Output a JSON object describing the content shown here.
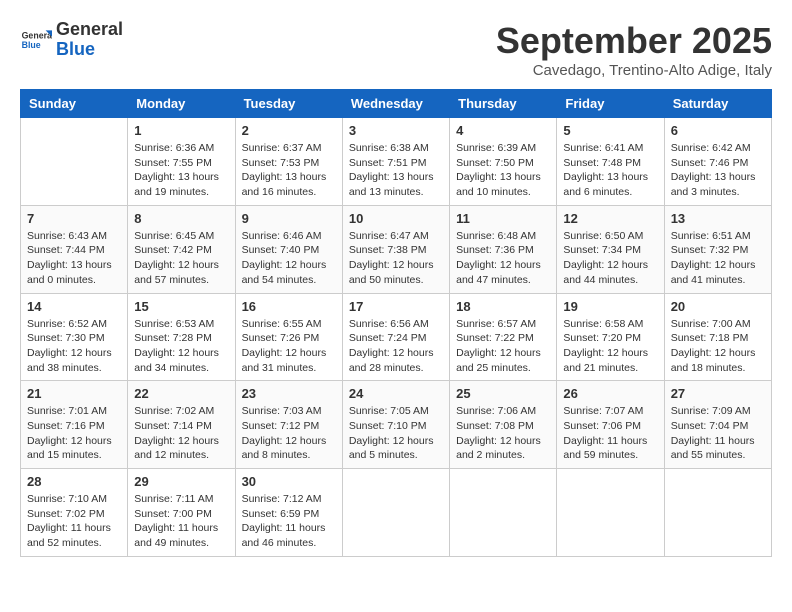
{
  "logo": {
    "general": "General",
    "blue": "Blue"
  },
  "header": {
    "title": "September 2025",
    "location": "Cavedago, Trentino-Alto Adige, Italy"
  },
  "days_of_week": [
    "Sunday",
    "Monday",
    "Tuesday",
    "Wednesday",
    "Thursday",
    "Friday",
    "Saturday"
  ],
  "weeks": [
    [
      {
        "day": "",
        "info": ""
      },
      {
        "day": "1",
        "info": "Sunrise: 6:36 AM\nSunset: 7:55 PM\nDaylight: 13 hours\nand 19 minutes."
      },
      {
        "day": "2",
        "info": "Sunrise: 6:37 AM\nSunset: 7:53 PM\nDaylight: 13 hours\nand 16 minutes."
      },
      {
        "day": "3",
        "info": "Sunrise: 6:38 AM\nSunset: 7:51 PM\nDaylight: 13 hours\nand 13 minutes."
      },
      {
        "day": "4",
        "info": "Sunrise: 6:39 AM\nSunset: 7:50 PM\nDaylight: 13 hours\nand 10 minutes."
      },
      {
        "day": "5",
        "info": "Sunrise: 6:41 AM\nSunset: 7:48 PM\nDaylight: 13 hours\nand 6 minutes."
      },
      {
        "day": "6",
        "info": "Sunrise: 6:42 AM\nSunset: 7:46 PM\nDaylight: 13 hours\nand 3 minutes."
      }
    ],
    [
      {
        "day": "7",
        "info": "Sunrise: 6:43 AM\nSunset: 7:44 PM\nDaylight: 13 hours\nand 0 minutes."
      },
      {
        "day": "8",
        "info": "Sunrise: 6:45 AM\nSunset: 7:42 PM\nDaylight: 12 hours\nand 57 minutes."
      },
      {
        "day": "9",
        "info": "Sunrise: 6:46 AM\nSunset: 7:40 PM\nDaylight: 12 hours\nand 54 minutes."
      },
      {
        "day": "10",
        "info": "Sunrise: 6:47 AM\nSunset: 7:38 PM\nDaylight: 12 hours\nand 50 minutes."
      },
      {
        "day": "11",
        "info": "Sunrise: 6:48 AM\nSunset: 7:36 PM\nDaylight: 12 hours\nand 47 minutes."
      },
      {
        "day": "12",
        "info": "Sunrise: 6:50 AM\nSunset: 7:34 PM\nDaylight: 12 hours\nand 44 minutes."
      },
      {
        "day": "13",
        "info": "Sunrise: 6:51 AM\nSunset: 7:32 PM\nDaylight: 12 hours\nand 41 minutes."
      }
    ],
    [
      {
        "day": "14",
        "info": "Sunrise: 6:52 AM\nSunset: 7:30 PM\nDaylight: 12 hours\nand 38 minutes."
      },
      {
        "day": "15",
        "info": "Sunrise: 6:53 AM\nSunset: 7:28 PM\nDaylight: 12 hours\nand 34 minutes."
      },
      {
        "day": "16",
        "info": "Sunrise: 6:55 AM\nSunset: 7:26 PM\nDaylight: 12 hours\nand 31 minutes."
      },
      {
        "day": "17",
        "info": "Sunrise: 6:56 AM\nSunset: 7:24 PM\nDaylight: 12 hours\nand 28 minutes."
      },
      {
        "day": "18",
        "info": "Sunrise: 6:57 AM\nSunset: 7:22 PM\nDaylight: 12 hours\nand 25 minutes."
      },
      {
        "day": "19",
        "info": "Sunrise: 6:58 AM\nSunset: 7:20 PM\nDaylight: 12 hours\nand 21 minutes."
      },
      {
        "day": "20",
        "info": "Sunrise: 7:00 AM\nSunset: 7:18 PM\nDaylight: 12 hours\nand 18 minutes."
      }
    ],
    [
      {
        "day": "21",
        "info": "Sunrise: 7:01 AM\nSunset: 7:16 PM\nDaylight: 12 hours\nand 15 minutes."
      },
      {
        "day": "22",
        "info": "Sunrise: 7:02 AM\nSunset: 7:14 PM\nDaylight: 12 hours\nand 12 minutes."
      },
      {
        "day": "23",
        "info": "Sunrise: 7:03 AM\nSunset: 7:12 PM\nDaylight: 12 hours\nand 8 minutes."
      },
      {
        "day": "24",
        "info": "Sunrise: 7:05 AM\nSunset: 7:10 PM\nDaylight: 12 hours\nand 5 minutes."
      },
      {
        "day": "25",
        "info": "Sunrise: 7:06 AM\nSunset: 7:08 PM\nDaylight: 12 hours\nand 2 minutes."
      },
      {
        "day": "26",
        "info": "Sunrise: 7:07 AM\nSunset: 7:06 PM\nDaylight: 11 hours\nand 59 minutes."
      },
      {
        "day": "27",
        "info": "Sunrise: 7:09 AM\nSunset: 7:04 PM\nDaylight: 11 hours\nand 55 minutes."
      }
    ],
    [
      {
        "day": "28",
        "info": "Sunrise: 7:10 AM\nSunset: 7:02 PM\nDaylight: 11 hours\nand 52 minutes."
      },
      {
        "day": "29",
        "info": "Sunrise: 7:11 AM\nSunset: 7:00 PM\nDaylight: 11 hours\nand 49 minutes."
      },
      {
        "day": "30",
        "info": "Sunrise: 7:12 AM\nSunset: 6:59 PM\nDaylight: 11 hours\nand 46 minutes."
      },
      {
        "day": "",
        "info": ""
      },
      {
        "day": "",
        "info": ""
      },
      {
        "day": "",
        "info": ""
      },
      {
        "day": "",
        "info": ""
      }
    ]
  ]
}
